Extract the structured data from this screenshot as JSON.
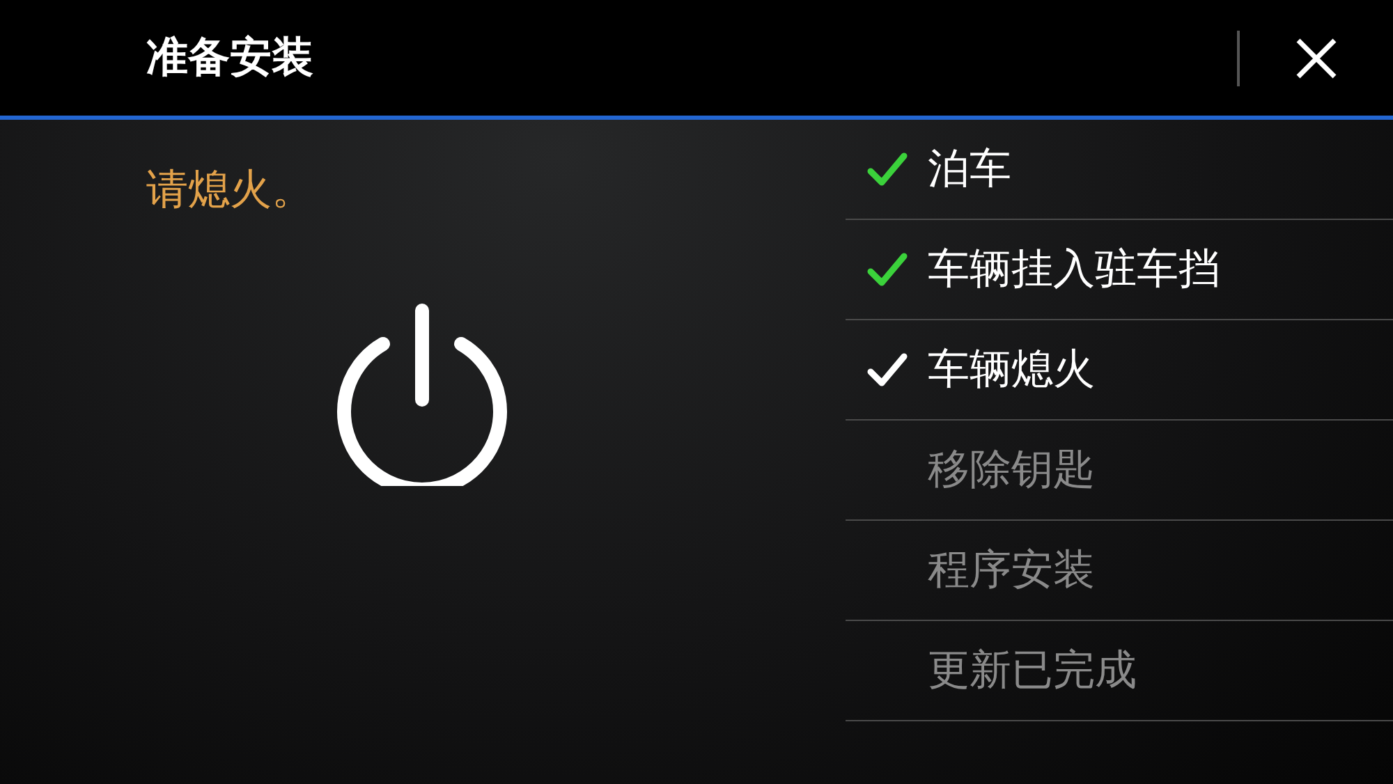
{
  "window": {
    "title": "准备安装"
  },
  "prompt": "请熄火。",
  "steps": [
    {
      "label": "泊车",
      "kind": "done"
    },
    {
      "label": "车辆挂入驻车挡",
      "kind": "done"
    },
    {
      "label": "车辆熄火",
      "kind": "current"
    },
    {
      "label": "移除钥匙",
      "kind": "pending"
    },
    {
      "label": "程序安装",
      "kind": "pending"
    },
    {
      "label": "更新已完成",
      "kind": "pending"
    }
  ]
}
